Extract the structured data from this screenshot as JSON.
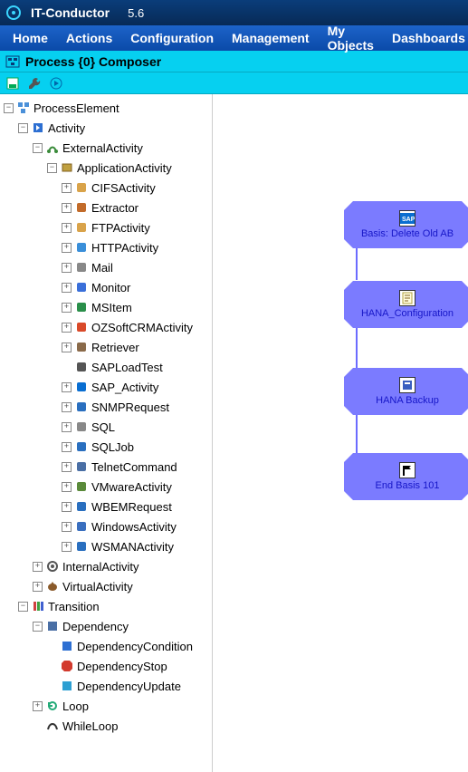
{
  "titlebar": {
    "app": "IT-Conductor",
    "version": "5.6"
  },
  "menu": [
    "Home",
    "Actions",
    "Configuration",
    "Management",
    "My Objects",
    "Dashboards"
  ],
  "subheader": {
    "title": "Process {0} Composer"
  },
  "tree": {
    "root": "ProcessElement",
    "activity": "Activity",
    "external": "ExternalActivity",
    "application": "ApplicationActivity",
    "app_items": [
      "CIFSActivity",
      "Extractor",
      "FTPActivity",
      "HTTPActivity",
      "Mail",
      "Monitor",
      "MSItem",
      "OZSoftCRMActivity",
      "Retriever",
      "SAPLoadTest",
      "SAP_Activity",
      "SNMPRequest",
      "SQL",
      "SQLJob",
      "TelnetCommand",
      "VMwareActivity",
      "WBEMRequest",
      "WindowsActivity",
      "WSMANActivity"
    ],
    "internal": "InternalActivity",
    "virtual": "VirtualActivity",
    "transition": "Transition",
    "dependency": "Dependency",
    "dep_items": [
      "DependencyCondition",
      "DependencyStop",
      "DependencyUpdate"
    ],
    "loop": "Loop",
    "whileloop": "WhileLoop"
  },
  "flow": {
    "n1": "Basis: Delete Old AB",
    "n2": "HANA_Configuration",
    "n3": "HANA Backup",
    "n4": "End Basis 101"
  }
}
